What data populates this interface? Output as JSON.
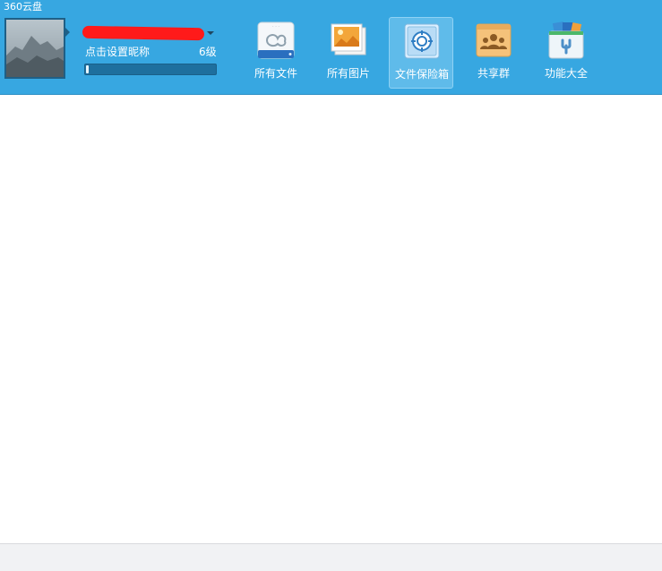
{
  "app": {
    "title": "360云盘"
  },
  "user": {
    "nickname_prompt": "点击设置昵称",
    "level": "6级",
    "level_progress": 0.02
  },
  "toolbar": {
    "items": [
      {
        "label": "所有文件",
        "icon": "cloud-drive-icon",
        "active": false
      },
      {
        "label": "所有图片",
        "icon": "photos-icon",
        "active": false
      },
      {
        "label": "文件保险箱",
        "icon": "safe-icon",
        "active": true
      },
      {
        "label": "共享群",
        "icon": "group-folder-icon",
        "active": false
      },
      {
        "label": "功能大全",
        "icon": "toolbox-icon",
        "active": false
      }
    ]
  },
  "colors": {
    "header_bg": "#37a7e1",
    "active_btn_bg": "#5fbbea",
    "redaction": "#ff1a1a"
  }
}
